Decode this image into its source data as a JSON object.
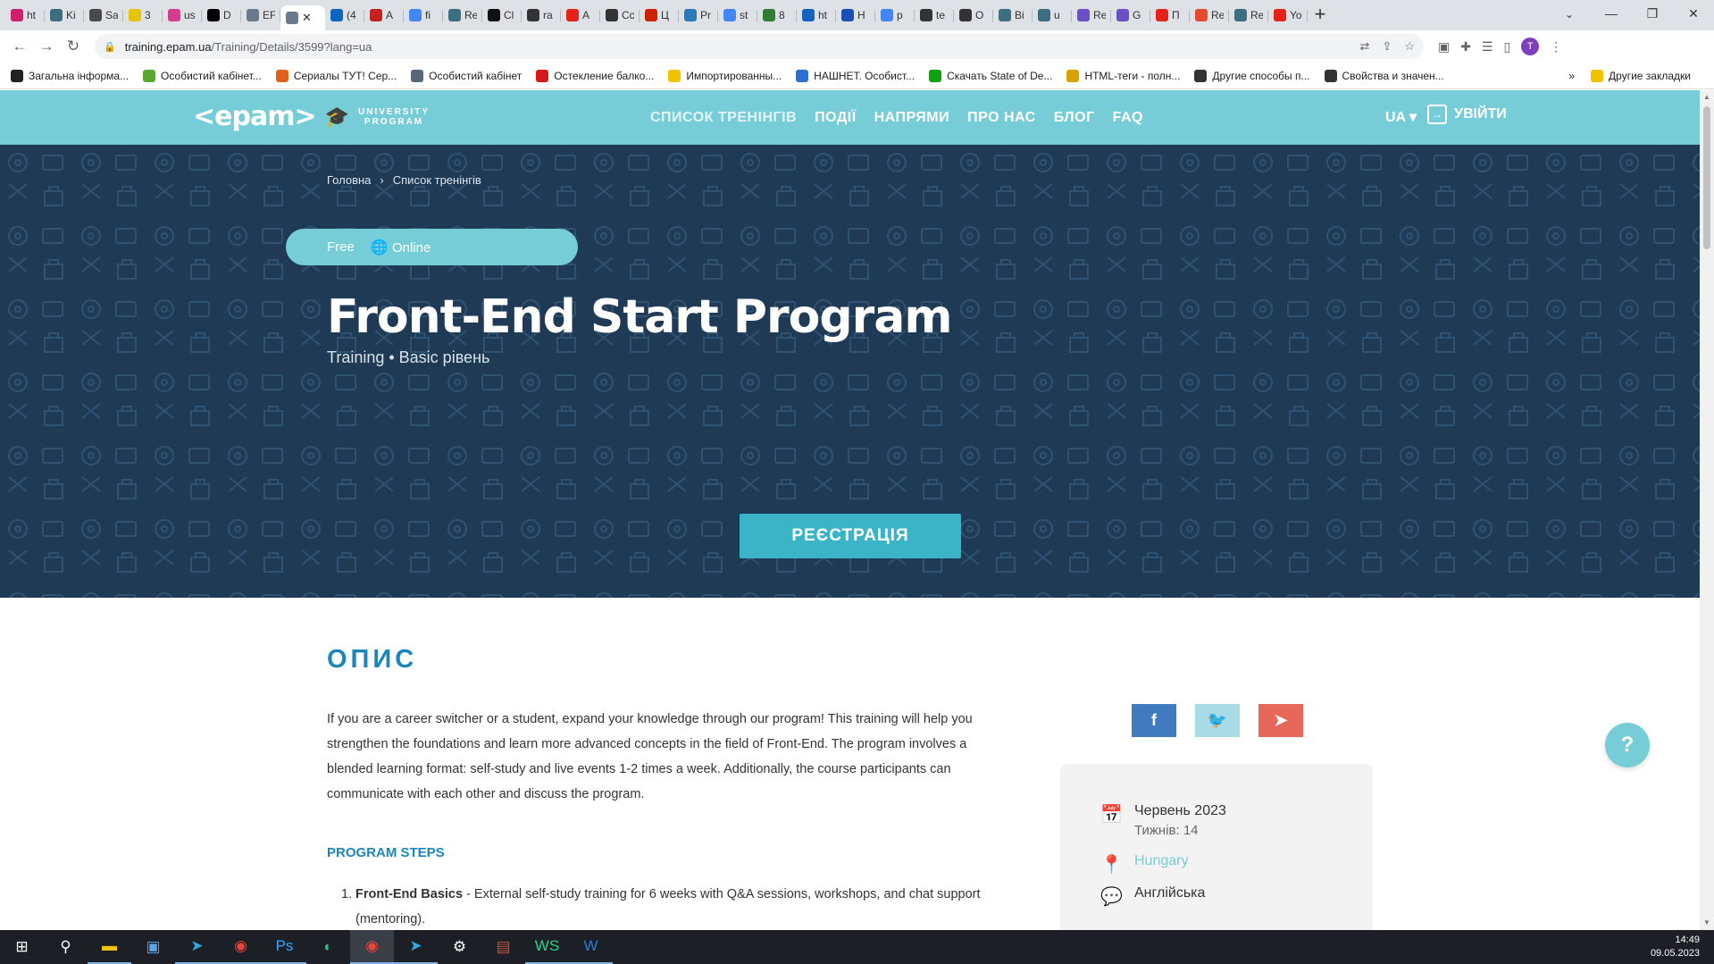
{
  "browser": {
    "tabs": [
      {
        "title": "ht",
        "color": "#d0206c",
        "icon": "circle-icon"
      },
      {
        "title": "Ki",
        "color": "#3d6e80",
        "icon": "react-icon"
      },
      {
        "title": "Sa",
        "color": "#4a4a4a",
        "icon": "doc-icon"
      },
      {
        "title": "3",
        "color": "#e6c400",
        "icon": "js-icon"
      },
      {
        "title": "us",
        "color": "#d43c8d",
        "icon": "square-icon"
      },
      {
        "title": "D",
        "color": "#000000",
        "icon": "d-icon"
      },
      {
        "title": "EF",
        "color": "#6a7a8a",
        "icon": "graduation-icon"
      },
      {
        "title": "",
        "color": "#6a7a8a",
        "icon": "graduation-icon",
        "active": true
      },
      {
        "title": "(4",
        "color": "#0a66c2",
        "icon": "linkedin-icon"
      },
      {
        "title": "A",
        "color": "#c5221f",
        "icon": "gmail-icon"
      },
      {
        "title": "fi",
        "color": "#4285f4",
        "icon": "google-icon"
      },
      {
        "title": "Re",
        "color": "#3d6e80",
        "icon": "react-icon"
      },
      {
        "title": "Cl",
        "color": "#111111",
        "icon": "github-icon"
      },
      {
        "title": "ra",
        "color": "#333333",
        "icon": "m-icon"
      },
      {
        "title": "A",
        "color": "#e62117",
        "icon": "youtube-icon"
      },
      {
        "title": "Cc",
        "color": "#333333",
        "icon": "shield-icon"
      },
      {
        "title": "Ц",
        "color": "#cc2200",
        "icon": "x-icon"
      },
      {
        "title": "Pr",
        "color": "#2b7ab8",
        "icon": "pr-icon"
      },
      {
        "title": "st",
        "color": "#4285f4",
        "icon": "google-icon"
      },
      {
        "title": "8",
        "color": "#2e7d32",
        "icon": "infinity-icon"
      },
      {
        "title": "ht",
        "color": "#1565c0",
        "icon": "wave-icon"
      },
      {
        "title": "H",
        "color": "#1a4fb5",
        "icon": "checker-icon"
      },
      {
        "title": "p",
        "color": "#4285f4",
        "icon": "google-icon"
      },
      {
        "title": "te",
        "color": "#333333",
        "icon": "m-icon"
      },
      {
        "title": "O",
        "color": "#333333",
        "icon": "lock-icon"
      },
      {
        "title": "Bi",
        "color": "#3d6e80",
        "icon": "react-icon"
      },
      {
        "title": "u",
        "color": "#3d6e80",
        "icon": "react-icon"
      },
      {
        "title": "Re",
        "color": "#6b4fc4",
        "icon": "redux-icon"
      },
      {
        "title": "G",
        "color": "#6b4fc4",
        "icon": "redux-icon"
      },
      {
        "title": "П",
        "color": "#e62117",
        "icon": "youtube-icon"
      },
      {
        "title": "Re",
        "color": "#e64a2e",
        "icon": "figma-icon"
      },
      {
        "title": "Re",
        "color": "#3d6e80",
        "icon": "react-icon"
      },
      {
        "title": "Yo",
        "color": "#e62117",
        "icon": "youtube-icon"
      }
    ],
    "url_host": "training.epam.ua",
    "url_path": "/Training/Details/3599?lang=ua",
    "profile_initial": "T",
    "bookmarks": [
      {
        "label": "Загальна інформа...",
        "color": "#222222"
      },
      {
        "label": "Особистий кабінет...",
        "color": "#5aa832"
      },
      {
        "label": "Сериалы ТУТ! Сер...",
        "color": "#e0601c"
      },
      {
        "label": "Особистий кабінет",
        "color": "#556677"
      },
      {
        "label": "Остекление балко...",
        "color": "#d81818"
      },
      {
        "label": "Импортированны...",
        "color": "#f2c200"
      },
      {
        "label": "НАШНЕТ. Особист...",
        "color": "#2c6fd1"
      },
      {
        "label": "Скачать State of De...",
        "color": "#11a011"
      },
      {
        "label": "HTML-теги - полн...",
        "color": "#d8a000"
      },
      {
        "label": "Другие способы п...",
        "color": "#333333"
      },
      {
        "label": "Свойства и значен...",
        "color": "#333333"
      }
    ],
    "bookmarks_more": "»",
    "other_bookmarks": "Другие закладки"
  },
  "site": {
    "brand": "<epam>",
    "program_line1": "UNIVERSITY",
    "program_line2": "PROGRAM",
    "nav": [
      "СПИСОК ТРЕНІНГІВ",
      "ПОДІЇ",
      "НАПРЯМИ",
      "ПРО НАС",
      "БЛОГ",
      "FAQ"
    ],
    "lang": "UA",
    "login": "УВІЙТИ"
  },
  "hero": {
    "breadcrumb_home": "Головна",
    "breadcrumb_sep": "›",
    "breadcrumb_current": "Список тренінгів",
    "price": "Free",
    "format": "Online",
    "title": "Front-End Start Program",
    "subtitle": "Training • Basic рівень",
    "register": "РЕЄСТРАЦІЯ"
  },
  "content": {
    "section_title": "ОПИС",
    "description": "If you are a career switcher or a student, expand your knowledge through our program! This training will help you strengthen the foundations and learn more advanced concepts in the field of Front-End. The program involves a blended learning format: self-study and live events 1-2 times a week. Additionally, the course participants can communicate with each other and discuss the program.",
    "steps_title": "PROGRAM STEPS",
    "steps": [
      {
        "num": "1.",
        "name": "Front-End Basics",
        "text": " - External self-study training for 6 weeks with Q&A sessions, workshops, and chat support (mentoring)."
      }
    ]
  },
  "sidebar": {
    "share": [
      {
        "label": "f",
        "color": "#3f7bbe",
        "icon": "facebook-icon"
      },
      {
        "label": "🐦",
        "color": "#a9dbe6",
        "icon": "twitter-icon"
      },
      {
        "label": "➤",
        "color": "#e7685a",
        "icon": "telegram-icon"
      }
    ],
    "date": "Червень 2023",
    "weeks": "Тижнів: 14",
    "location": "Hungary",
    "language": "Англійська"
  },
  "help_label": "?",
  "taskbar": {
    "time": "14:49",
    "date": "09.05.2023"
  },
  "colors": {
    "accent": "#76cdd8",
    "hero_bg": "#1f3a55",
    "heading_blue": "#1a86bd",
    "button": "#3cb4c8"
  }
}
